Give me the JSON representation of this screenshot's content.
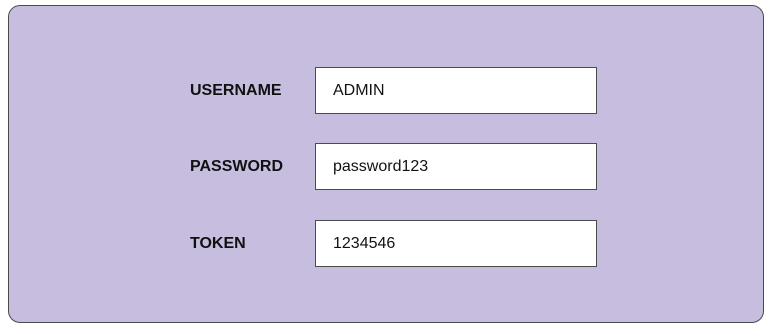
{
  "form": {
    "username": {
      "label": "USERNAME",
      "value": "ADMIN"
    },
    "password": {
      "label": "PASSWORD",
      "value": "password123"
    },
    "token": {
      "label": "TOKEN",
      "value": "1234546"
    }
  },
  "colors": {
    "panel_background": "#c7bedf",
    "panel_border": "#4b4b4b",
    "field_background": "#ffffff",
    "text": "#111111"
  }
}
